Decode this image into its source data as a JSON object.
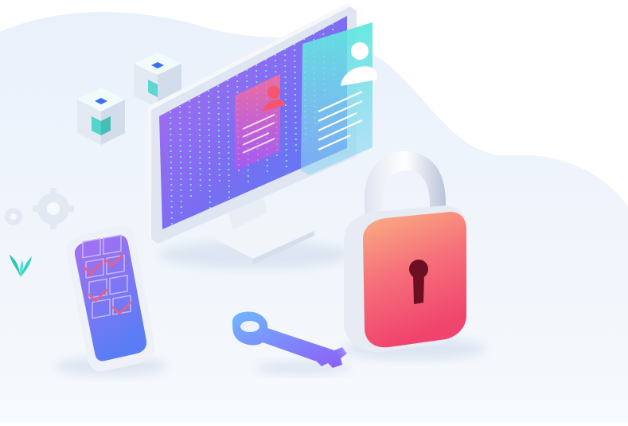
{
  "illustration": {
    "colors": {
      "background_blob": "#eef3fb",
      "screen_start": "#a770ef",
      "screen_end": "#4f7cf7",
      "panel_teal": "#5ee7df",
      "card_red": "#f45c7a",
      "lock_body_start": "#f7a07a",
      "lock_body_end": "#f2456e",
      "shackle": "#c9d2e4",
      "key_start": "#6ea8ff",
      "key_end": "#8e5cf7",
      "cube_top": "#e8f8f6",
      "cube_accent": "#3ad1c4",
      "gear": "#e6ebf3",
      "plant": "#2fc7b4",
      "check": "#f45c7a"
    },
    "icons": [
      "monitor-icon",
      "user-profile-icon",
      "padlock-icon",
      "key-icon",
      "smartphone-icon",
      "checklist-icon",
      "gear-icon",
      "server-cube-icon",
      "plant-icon"
    ]
  }
}
